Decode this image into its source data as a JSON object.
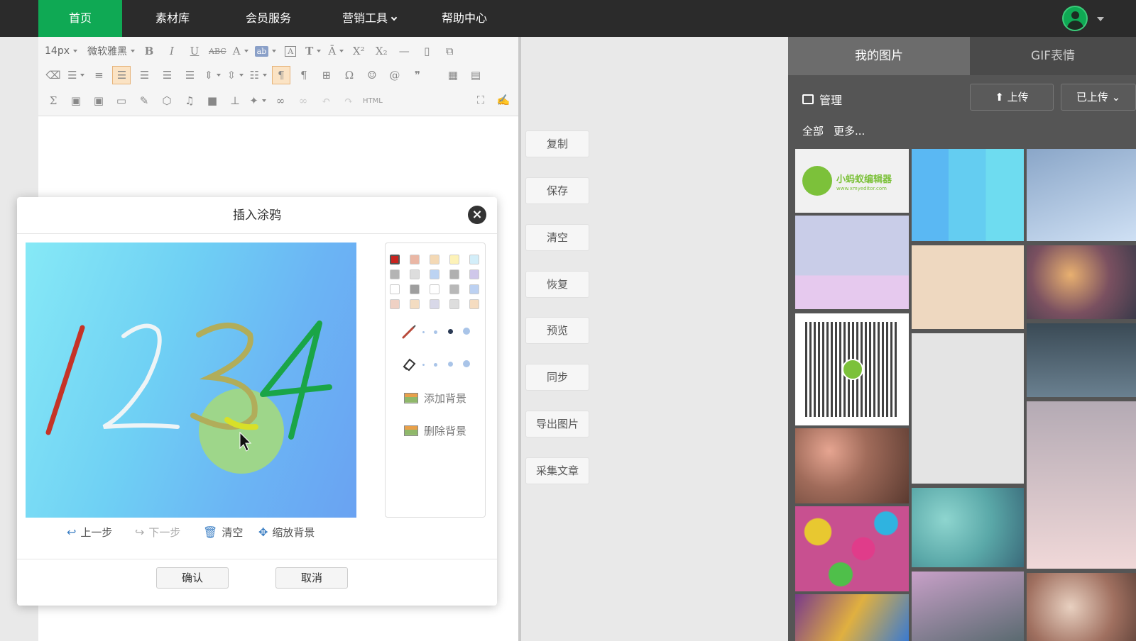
{
  "nav": {
    "items": [
      {
        "label": "首页",
        "active": true
      },
      {
        "label": "素材库"
      },
      {
        "label": "会员服务"
      },
      {
        "label": "营销工具",
        "dropdown": true
      },
      {
        "label": "帮助中心"
      }
    ]
  },
  "toolbar": {
    "font_size": "14px",
    "font_family": "微软雅黑",
    "html_label": "HTML"
  },
  "side_buttons": [
    "复制",
    "保存",
    "清空",
    "恢复",
    "预览",
    "同步",
    "导出图片",
    "采集文章"
  ],
  "right_panel": {
    "tabs": [
      {
        "label": "我的图片",
        "active": true
      },
      {
        "label": "GIF表情"
      }
    ],
    "manage_label": "管理",
    "upload_label": "上传",
    "uploaded_label": "已上传",
    "filters": [
      "全部",
      "更多..."
    ],
    "logo_title": "小蚂蚁编辑器",
    "logo_url": "www.xmyeditor.com"
  },
  "modal": {
    "title": "插入涂鸦",
    "close_symbol": "×",
    "drawing_text": "1234",
    "palette_colors": [
      "#c8241f",
      "#eab7a5",
      "#f4d9b5",
      "#fdf2b8",
      "#d3eef9",
      "#b4b4b4",
      "#dddddd",
      "#bcd3f2",
      "#b0b0b0",
      "#cfc7ea",
      "#ffffff",
      "#9e9e9e",
      "#ffffff",
      "#b8b8b8",
      "#bcd1f2",
      "#efd1c4",
      "#f3dcc1",
      "#d8d8e8",
      "#dddddd",
      "#f5dcc0"
    ],
    "add_bg_label": "添加背景",
    "remove_bg_label": "删除背景",
    "controls": {
      "undo": "上一步",
      "redo": "下一步",
      "clear": "清空",
      "scale_bg": "缩放背景"
    },
    "confirm_label": "确认",
    "cancel_label": "取消"
  }
}
